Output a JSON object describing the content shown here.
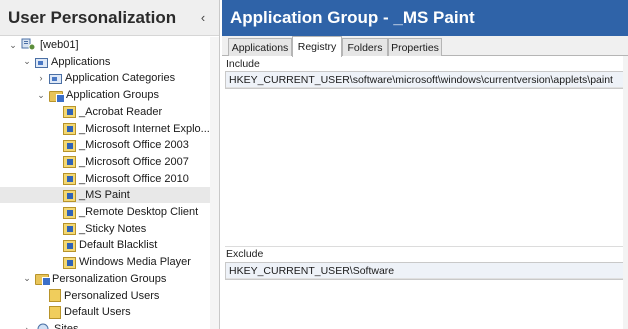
{
  "left": {
    "title": "User Personalization",
    "collapse_glyph": "‹",
    "tree": [
      {
        "label": "[web01]",
        "icon": "server-icon",
        "toggle": "⌄",
        "depth": 0
      },
      {
        "label": "Applications",
        "icon": "application-icon",
        "toggle": "⌄",
        "depth": 1
      },
      {
        "label": "Application Categories",
        "icon": "application-icon",
        "toggle": "›",
        "depth": 2
      },
      {
        "label": "Application Groups",
        "icon": "group-folder-icon",
        "toggle": "⌄",
        "depth": 2
      },
      {
        "label": "_Acrobat Reader",
        "icon": "app-group-item-icon",
        "toggle": "",
        "depth": 3
      },
      {
        "label": "_Microsoft Internet Explo...",
        "icon": "app-group-item-icon",
        "toggle": "",
        "depth": 3
      },
      {
        "label": "_Microsoft Office 2003",
        "icon": "app-group-item-icon",
        "toggle": "",
        "depth": 3
      },
      {
        "label": "_Microsoft Office 2007",
        "icon": "app-group-item-icon",
        "toggle": "",
        "depth": 3
      },
      {
        "label": "_Microsoft Office 2010",
        "icon": "app-group-item-icon",
        "toggle": "",
        "depth": 3
      },
      {
        "label": "_MS Paint",
        "icon": "app-group-item-icon",
        "toggle": "",
        "depth": 3,
        "selected": true
      },
      {
        "label": "_Remote Desktop Client",
        "icon": "app-group-item-icon",
        "toggle": "",
        "depth": 3
      },
      {
        "label": "_Sticky Notes",
        "icon": "app-group-item-icon",
        "toggle": "",
        "depth": 3
      },
      {
        "label": "Default Blacklist",
        "icon": "app-group-item-icon",
        "toggle": "",
        "depth": 3
      },
      {
        "label": "Windows Media Player",
        "icon": "app-group-item-icon",
        "toggle": "",
        "depth": 3
      },
      {
        "label": "Personalization Groups",
        "icon": "group-folder-icon",
        "toggle": "⌄",
        "depth": 1
      },
      {
        "label": "Personalized Users",
        "icon": "user-folder-icon",
        "toggle": "",
        "depth": 2
      },
      {
        "label": "Default Users",
        "icon": "user-folder-icon",
        "toggle": "",
        "depth": 2
      },
      {
        "label": "Sites",
        "icon": "sites-icon",
        "toggle": "›",
        "depth": 1
      }
    ]
  },
  "right": {
    "title": "Application Group - _MS Paint",
    "tabs": [
      "Applications",
      "Registry",
      "Folders",
      "Properties"
    ],
    "active_tab": "Registry",
    "include_label": "Include",
    "include_rows": [
      "HKEY_CURRENT_USER\\software\\microsoft\\windows\\currentversion\\applets\\paint"
    ],
    "exclude_label": "Exclude",
    "exclude_rows": [
      "HKEY_CURRENT_USER\\Software"
    ]
  },
  "colors": {
    "header_blue": "#2f63a8",
    "selected_row": "#e8e8e8",
    "row_tint": "#eef2f8"
  }
}
